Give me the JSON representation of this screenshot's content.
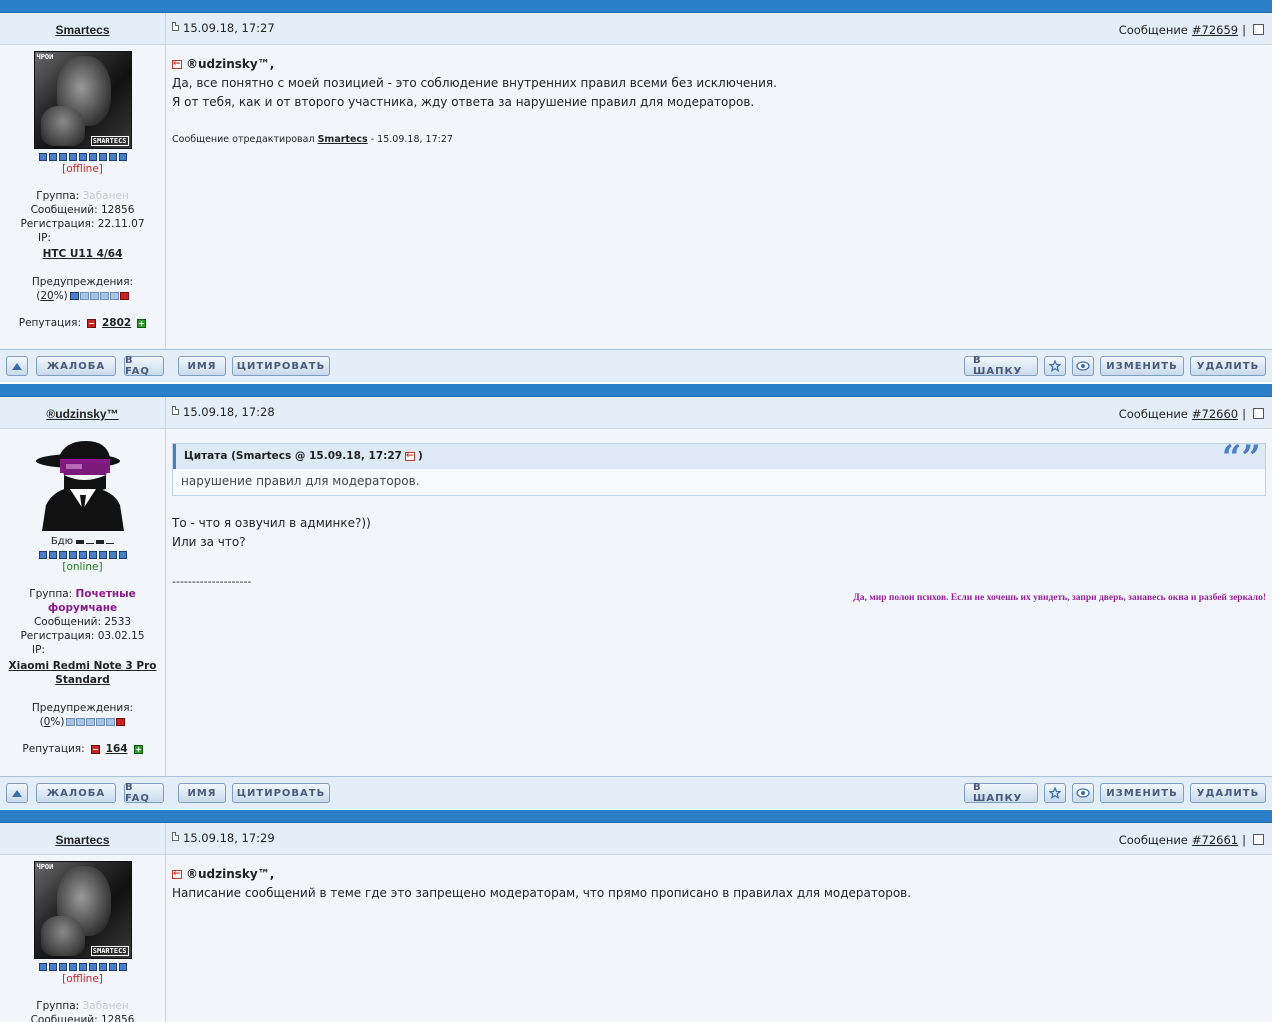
{
  "posts": [
    {
      "user": "Smartecs",
      "date": "15.09.18, 17:27",
      "msg_label": "Сообщение",
      "msg_num": "#72659",
      "sep": "|",
      "avatar_type": "photo",
      "avatar_tag1": "ЧРОИ",
      "avatar_tag2": "SMARTECS",
      "status": "[offline]",
      "group_label": "Группа:",
      "group_value": "Забанен",
      "messages": "Сообщений: 12856",
      "registration": "Регистрация: 22.11.07",
      "ip": "IP:",
      "device_line1": "HTC U11 4/64",
      "device_line2": "",
      "warn_label": "Предупреждения:",
      "warn_value": "20",
      "rep_label": "Репутация:",
      "rep_value": "2802",
      "mention": "®udzinsky™,",
      "lines": [
        "Да, все понятно с моей позицией - это соблюдение внутренних правил всеми без исключения.",
        "Я от тебя, как и от второго участника, жду ответа за нарушение правил для модераторов."
      ],
      "edited_prefix": "Сообщение отредактировал",
      "edited_user": "Smartecs",
      "edited_suffix": "- 15.09.18, 17:27"
    },
    {
      "user": "®udzinsky™",
      "date": "15.09.18, 17:28",
      "msg_label": "Сообщение",
      "msg_num": "#72660",
      "sep": "|",
      "avatar_type": "hat",
      "nick_under": "Бдю",
      "status": "[online]",
      "group_label": "Группа:",
      "group_value": "Почетные форумчане",
      "messages": "Сообщений: 2533",
      "registration": "Регистрация: 03.02.15",
      "ip": "IP:",
      "device_line1": "Xiaomi Redmi Note 3 Pro",
      "device_line2": "Standard",
      "warn_label": "Предупреждения:",
      "warn_value": "0",
      "rep_label": "Репутация:",
      "rep_value": "164",
      "quote_head": "Цитата (Smartecs @ 15.09.18, 17:27",
      "quote_close": ")",
      "quote_text": "нарушение правил для модераторов.",
      "quote_mark": "“”",
      "lines": [
        "То - что я озвучил в админке?))",
        "Или за что?"
      ],
      "dashes": "--------------------",
      "signature": "Да, мир полон психов. Если не хочешь их увидеть, запри дверь, занавесь окна и разбей зеркало!"
    },
    {
      "user": "Smartecs",
      "date": "15.09.18, 17:29",
      "msg_label": "Сообщение",
      "msg_num": "#72661",
      "sep": "|",
      "avatar_type": "photo",
      "avatar_tag1": "ЧРОИ",
      "avatar_tag2": "SMARTECS",
      "status": "[offline]",
      "group_label": "Группа:",
      "group_value": "Забанен",
      "messages": "Сообщений: 12856",
      "mention": "®udzinsky™,",
      "lines": [
        "Написание сообщений в теме где это запрещено модераторам, что прямо прописано в правилах для модераторов."
      ]
    }
  ],
  "buttons": {
    "complaint": "ЖАЛОБА",
    "faq": "В FAQ",
    "name": "ИМЯ",
    "quote": "ЦИТИРОВАТЬ",
    "to_header": "В ШАПКУ",
    "edit": "ИЗМЕНИТЬ",
    "delete": "УДАЛИТЬ"
  },
  "icons": {
    "up": "arrow-up-icon",
    "pin": "pin-icon",
    "eye": "eye-icon",
    "doc": "document-icon",
    "back": "back-arrow-icon",
    "checkbox": "checkbox-icon"
  },
  "colors": {
    "bar": "#2b7fc8",
    "header_bg": "#e4eef8",
    "body_bg": "#f2f6fb",
    "offline": "#cc2222",
    "online": "#1a7a1a",
    "honor": "#8a1a8a",
    "signature": "#9b1f9b"
  }
}
